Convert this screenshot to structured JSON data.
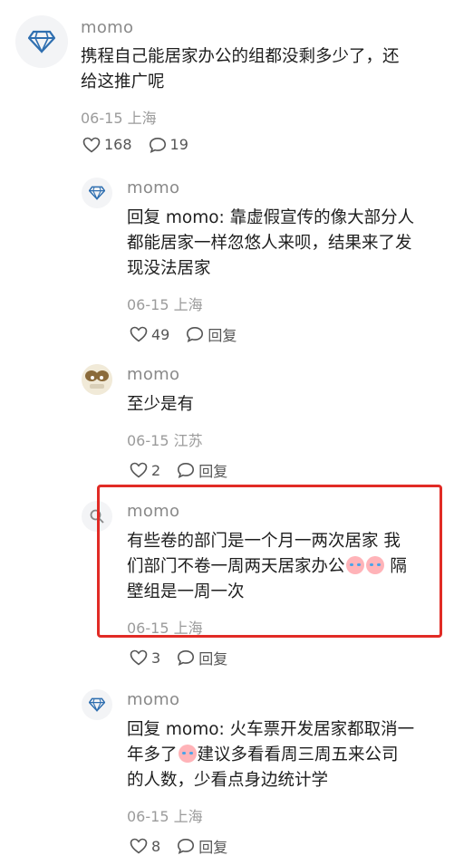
{
  "comments": [
    {
      "username": "momo",
      "text_lines": [
        "携程自己能居家办公的组都没剩多少了，还",
        "给这推广呢"
      ],
      "meta": "06-15 上海",
      "likes": "168",
      "replies": "19",
      "avatar_icon": "diamond-icon"
    },
    {
      "username": "momo",
      "text_lines": [
        "回复 momo: 靠虚假宣传的像大部分人",
        "都能居家一样忽悠人来呗，结果来了发",
        "现没法居家"
      ],
      "meta": "06-15 上海",
      "likes": "49",
      "reply_label": "回复",
      "avatar_icon": "diamond-icon"
    },
    {
      "username": "momo",
      "text_lines": [
        "至少是有"
      ],
      "meta": "06-15 江苏",
      "likes": "2",
      "reply_label": "回复",
      "avatar_icon": "cartoon-avatar"
    },
    {
      "username": "momo",
      "text_lines": [
        "有些卷的部门是一个月一两次居家 我",
        "们部门不卷一周两天居家办公",
        "壁组是一周一次"
      ],
      "line2_suffix": " 隔",
      "meta": "06-15 上海",
      "likes": "3",
      "reply_label": "回复",
      "avatar_icon": "search-avatar"
    },
    {
      "username": "momo",
      "text_lines": [
        "回复 momo: 火车票开发居家都取消一",
        "年多了",
        "的人数，少看点身边统计学"
      ],
      "line2_suffix": "建议多看看周三周五来公司",
      "meta": "06-15 上海",
      "likes": "8",
      "reply_label": "回复",
      "avatar_icon": "diamond-icon"
    }
  ],
  "colors": {
    "highlight": "#e12b25",
    "diamond": "#2f6fb0"
  }
}
